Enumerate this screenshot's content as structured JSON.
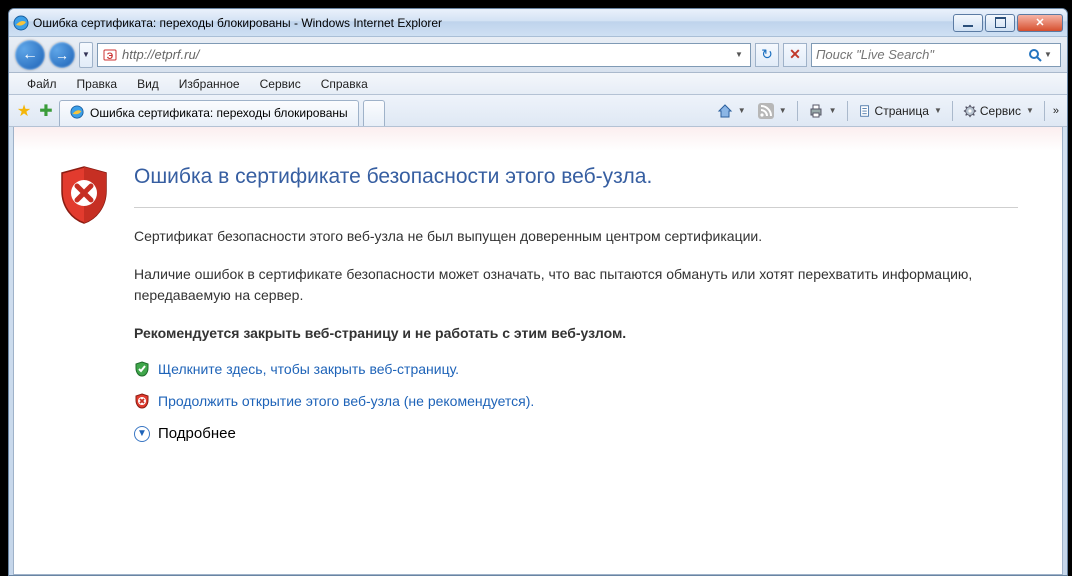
{
  "window": {
    "title": "Ошибка сертификата: переходы блокированы - Windows Internet Explorer"
  },
  "nav": {
    "url": "http://etprf.ru/",
    "search_placeholder": "Поиск \"Live Search\""
  },
  "menu": [
    "Файл",
    "Правка",
    "Вид",
    "Избранное",
    "Сервис",
    "Справка"
  ],
  "tab": {
    "title": "Ошибка сертификата: переходы блокированы"
  },
  "cmd": {
    "page_label": "Страница",
    "tools_label": "Сервис"
  },
  "page": {
    "heading": "Ошибка в сертификате безопасности этого веб-узла.",
    "msg1": "Сертификат безопасности этого веб-узла не был выпущен доверенным центром сертификации.",
    "msg2": "Наличие ошибок в сертификате безопасности может означать, что вас пытаются обмануть или хотят перехватить информацию, передаваемую на сервер.",
    "msg3": "Рекомендуется закрыть веб-страницу и не работать с этим веб-узлом.",
    "close_link": "Щелкните здесь, чтобы закрыть веб-страницу.",
    "continue_link": "Продолжить открытие этого веб-узла (не рекомендуется).",
    "more_label": "Подробнее"
  }
}
